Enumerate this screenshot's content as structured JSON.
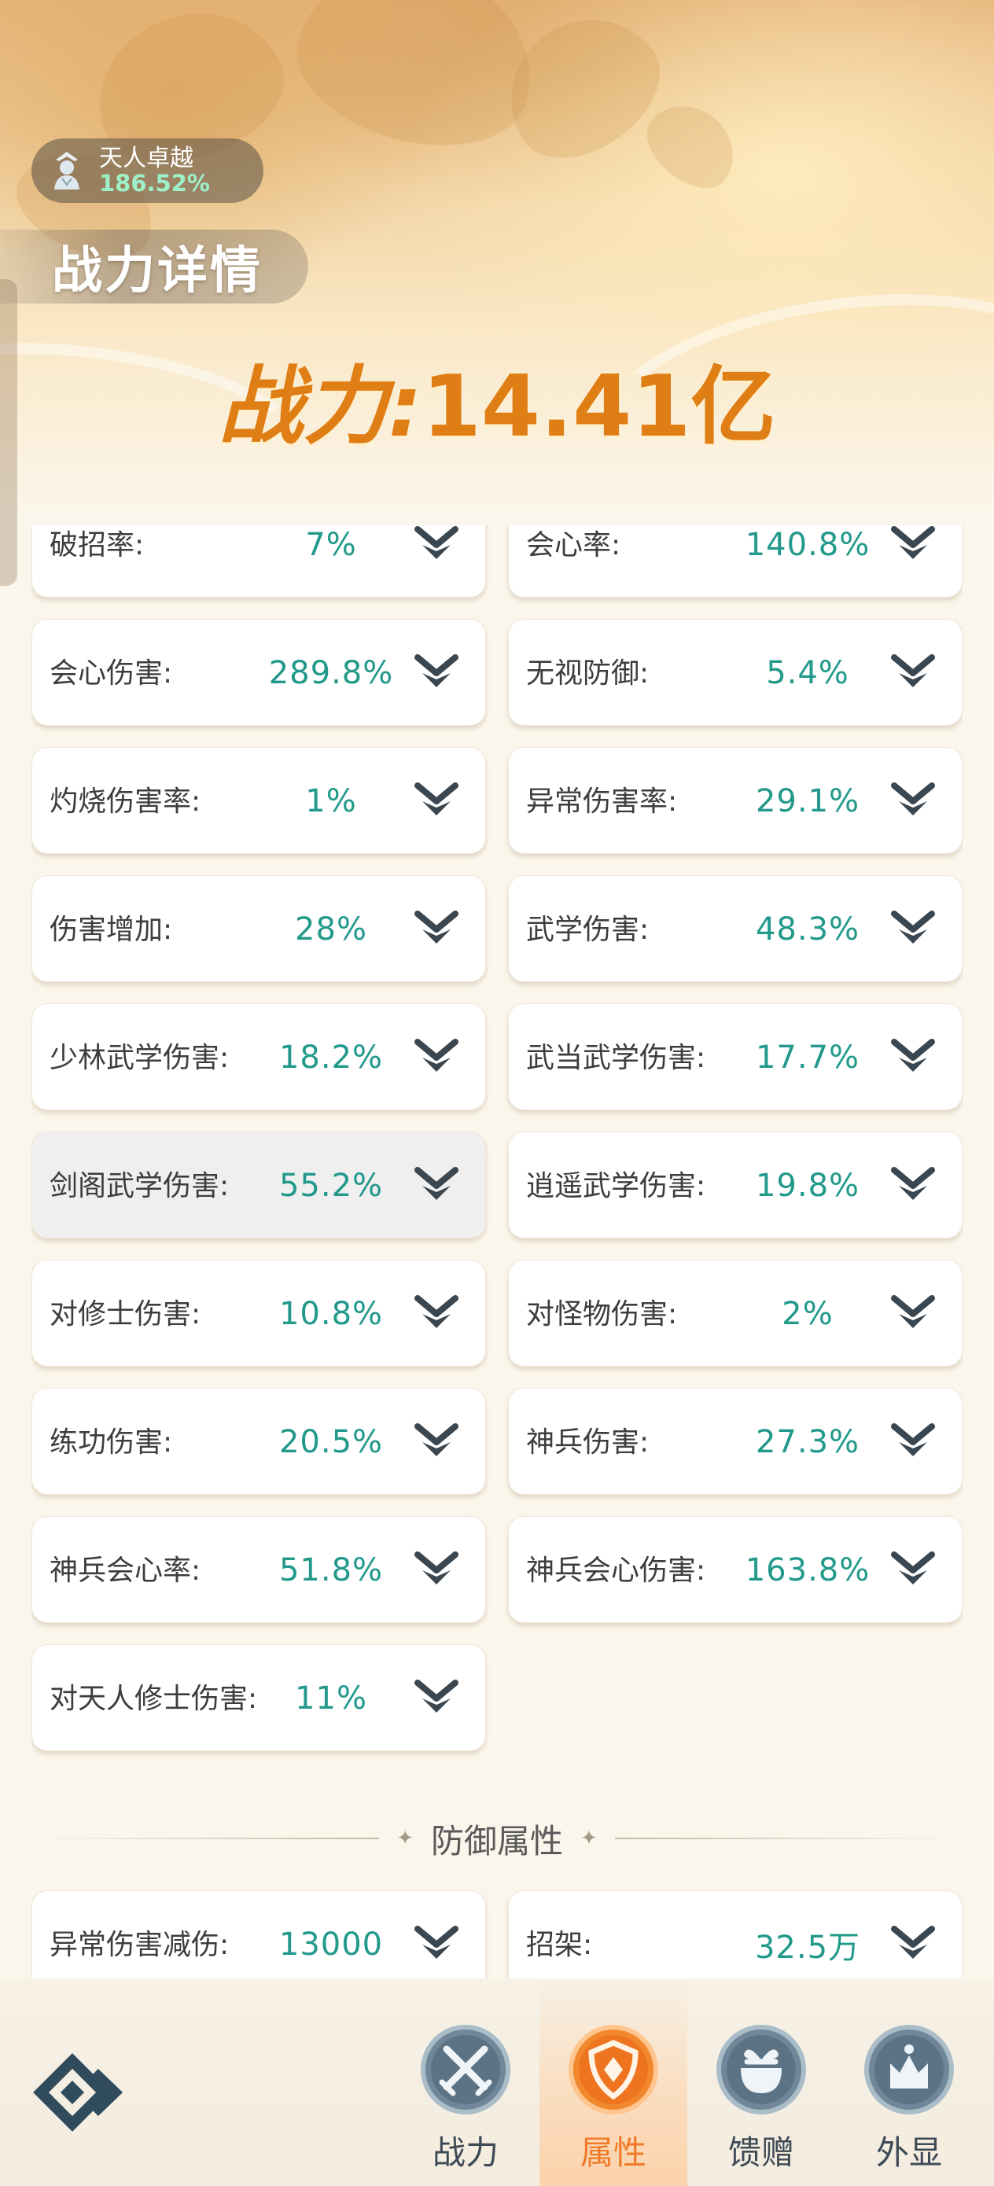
{
  "header": {
    "rank_name": "天人卓越",
    "rank_percent": "186.52%",
    "title": "战力详情",
    "power_label": "战力:",
    "power_value": "14.41亿"
  },
  "stats": [
    {
      "label": "破招率:",
      "value": "7%"
    },
    {
      "label": "会心率:",
      "value": "140.8%"
    },
    {
      "label": "会心伤害:",
      "value": "289.8%"
    },
    {
      "label": "无视防御:",
      "value": "5.4%"
    },
    {
      "label": "灼烧伤害率:",
      "value": "1%"
    },
    {
      "label": "异常伤害率:",
      "value": "29.1%"
    },
    {
      "label": "伤害增加:",
      "value": "28%"
    },
    {
      "label": "武学伤害:",
      "value": "48.3%"
    },
    {
      "label": "少林武学伤害:",
      "value": "18.2%"
    },
    {
      "label": "武当武学伤害:",
      "value": "17.7%"
    },
    {
      "label": "剑阁武学伤害:",
      "value": "55.2%"
    },
    {
      "label": "逍遥武学伤害:",
      "value": "19.8%"
    },
    {
      "label": "对修士伤害:",
      "value": "10.8%"
    },
    {
      "label": "对怪物伤害:",
      "value": "2%"
    },
    {
      "label": "练功伤害:",
      "value": "20.5%"
    },
    {
      "label": "神兵伤害:",
      "value": "27.3%"
    },
    {
      "label": "神兵会心率:",
      "value": "51.8%"
    },
    {
      "label": "神兵会心伤害:",
      "value": "163.8%"
    },
    {
      "label": "对天人修士伤害:",
      "value": "11%"
    }
  ],
  "defense_section": {
    "title": "防御属性",
    "stats": [
      {
        "label": "异常伤害减伤:",
        "value": "13000"
      },
      {
        "label": "招架:",
        "value": "32.5万"
      }
    ]
  },
  "nav": {
    "items": [
      {
        "label": "战力",
        "icon": "sword-icon"
      },
      {
        "label": "属性",
        "icon": "shield-icon",
        "active": true
      },
      {
        "label": "馈赠",
        "icon": "gift-icon"
      },
      {
        "label": "外显",
        "icon": "crown-icon"
      }
    ]
  },
  "colors": {
    "value_teal": "#22998a",
    "power_orange": "#e07e16",
    "nav_active": "#f07a27"
  }
}
